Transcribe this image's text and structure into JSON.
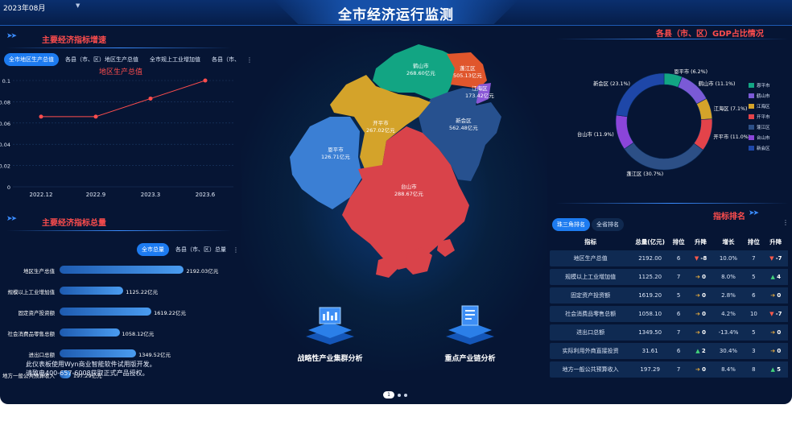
{
  "header": {
    "title": "全市经济运行监测",
    "date_value": "2023年08月"
  },
  "growth_panel": {
    "title": "主要经济指标增速",
    "tabs": [
      "全市地区生产总值",
      "各县（市、区）地区生产总值",
      "全市规上工业增加值",
      "各县（市、"
    ],
    "menu_icon": "⋮",
    "chart_data": {
      "type": "line",
      "title": "地区生产总值",
      "categories": [
        "2022.12",
        "2022.9",
        "2023.3",
        "2023.6"
      ],
      "values": [
        0.066,
        0.066,
        0.083,
        0.1
      ],
      "ylim": [
        0,
        0.1
      ],
      "yticks": [
        "0.1",
        "0.08",
        "0.06",
        "0.04",
        "0.02",
        "0"
      ],
      "color": "#ff4d4d"
    }
  },
  "total_panel": {
    "title": "主要经济指标总量",
    "tabs": [
      "全市总量",
      "各县（市、区）总量"
    ],
    "menu_icon": "⋮",
    "chart_data": {
      "type": "bar",
      "categories": [
        "地区生产总值",
        "规模以上工业增加值",
        "固定资产投资额",
        "社会消费品零售总额",
        "进出口总额",
        "地方一般公共预算收入"
      ],
      "values": [
        2192.03,
        1125.22,
        1619.22,
        1058.12,
        1349.52,
        197.29
      ],
      "value_labels": [
        "2192.03亿元",
        "1125.22亿元",
        "1619.22亿元",
        "1058.12亿元",
        "1349.52亿元",
        "197.29亿元"
      ],
      "xlim": [
        0,
        2200
      ]
    }
  },
  "watermark": {
    "line1": "此仪表板使用Wyn商业智能软件试用版开发。",
    "line2": "请致电400-657-6008获取正式产品授权。"
  },
  "map": {
    "regions": [
      {
        "name": "鹤山市",
        "value": "268.60亿元",
        "color": "#12a583"
      },
      {
        "name": "蓬江区",
        "value": "505.13亿元",
        "color": "#e0562c"
      },
      {
        "name": "江海区",
        "value": "173.42亿元",
        "color": "#8a57d6"
      },
      {
        "name": "新会区",
        "value": "562.48亿元",
        "color": "#27518f"
      },
      {
        "name": "开平市",
        "value": "267.02亿元",
        "color": "#d4a32a"
      },
      {
        "name": "恩平市",
        "value": "126.71亿元",
        "color": "#3b7fd4"
      },
      {
        "name": "台山市",
        "value": "288.67亿元",
        "color": "#d9434a"
      }
    ]
  },
  "features": [
    {
      "label": "战略性产业集群分析",
      "icon": "dashboard-cube-icon"
    },
    {
      "label": "重点产业链分析",
      "icon": "document-cube-icon"
    }
  ],
  "gdp_share": {
    "title": "各县（市、区）GDP占比情况",
    "chart_data": {
      "type": "pie",
      "slices": [
        {
          "name": "恩平市",
          "value": 6.2,
          "label": "恩平市 (6.2%)",
          "color": "#12a583"
        },
        {
          "name": "鹤山市",
          "value": 11.1,
          "label": "鹤山市 (11.1%)",
          "color": "#7a5ad6"
        },
        {
          "name": "江海区",
          "value": 7.1,
          "label": "江海区 (7.1%)",
          "color": "#d4a32a"
        },
        {
          "name": "开平市",
          "value": 11.0,
          "label": "开平市 (11.0%)",
          "color": "#e3434a"
        },
        {
          "name": "蓬江区",
          "value": 30.7,
          "label": "蓬江区 (30.7%)",
          "color": "#2c4f86"
        },
        {
          "name": "台山市",
          "value": 11.9,
          "label": "台山市 (11.9%)",
          "color": "#8b45d9"
        },
        {
          "name": "新会区",
          "value": 23.1,
          "label": "新会区 (23.1%)",
          "color": "#1e47a8"
        }
      ],
      "legend": [
        "恩平市",
        "鹤山市",
        "江海区",
        "开平市",
        "蓬江区",
        "台山市",
        "新会区"
      ],
      "legend_position": "right"
    }
  },
  "ranking": {
    "title": "指标排名",
    "tabs": [
      "珠三角排名",
      "全省排名"
    ],
    "menu_icon": "⋮",
    "columns": [
      "指标",
      "总量(亿元)",
      "排位",
      "升降",
      "增长",
      "排位",
      "升降"
    ],
    "rows": [
      {
        "name": "地区生产总值",
        "total": "2192.00",
        "rank1": "6",
        "change1": "-8",
        "dir1": "down",
        "growth": "10.0%",
        "rank2": "7",
        "change2": "-7",
        "dir2": "down"
      },
      {
        "name": "规模以上工业增加值",
        "total": "1125.20",
        "rank1": "7",
        "change1": "0",
        "dir1": "flat",
        "growth": "8.0%",
        "rank2": "5",
        "change2": "4",
        "dir2": "up"
      },
      {
        "name": "固定资产投资额",
        "total": "1619.20",
        "rank1": "5",
        "change1": "0",
        "dir1": "flat",
        "growth": "2.8%",
        "rank2": "6",
        "change2": "0",
        "dir2": "flat"
      },
      {
        "name": "社会消费品零售总额",
        "total": "1058.10",
        "rank1": "6",
        "change1": "0",
        "dir1": "flat",
        "growth": "4.2%",
        "rank2": "10",
        "change2": "-7",
        "dir2": "down"
      },
      {
        "name": "进出口总额",
        "total": "1349.50",
        "rank1": "7",
        "change1": "0",
        "dir1": "flat",
        "growth": "-13.4%",
        "rank2": "5",
        "change2": "0",
        "dir2": "flat"
      },
      {
        "name": "实际利用外商直接投资",
        "total": "31.61",
        "rank1": "6",
        "change1": "2",
        "dir1": "up",
        "growth": "30.4%",
        "rank2": "3",
        "change2": "0",
        "dir2": "flat"
      },
      {
        "name": "地方一般公共预算收入",
        "total": "197.29",
        "rank1": "7",
        "change1": "0",
        "dir1": "flat",
        "growth": "8.4%",
        "rank2": "8",
        "change2": "5",
        "dir2": "up"
      }
    ]
  },
  "pager": {
    "current": "1"
  }
}
